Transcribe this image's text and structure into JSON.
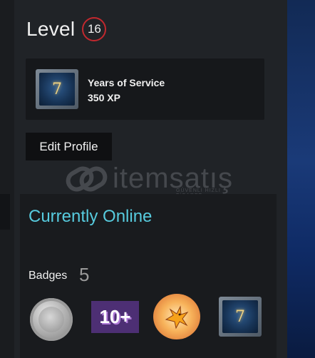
{
  "level": {
    "title": "Level",
    "number": "16",
    "ring_color": "#c2282e"
  },
  "service_badge": {
    "icon_label": "7",
    "title": "Years of Service",
    "xp": "350 XP"
  },
  "edit_profile": {
    "label": "Edit Profile"
  },
  "watermark": {
    "text": "itemsatış",
    "subtext": "GÜVENLİ HIZLI TİCARET .com"
  },
  "online": {
    "status": "Currently Online",
    "color": "#57cbde"
  },
  "badges": {
    "label": "Badges",
    "count": "5",
    "items": [
      {
        "icon": "silver-coin-icon"
      },
      {
        "icon": "ten-plus-icon",
        "text": "10+"
      },
      {
        "icon": "phoenix-icon"
      },
      {
        "icon": "years-of-service-icon",
        "text": "7"
      }
    ]
  }
}
